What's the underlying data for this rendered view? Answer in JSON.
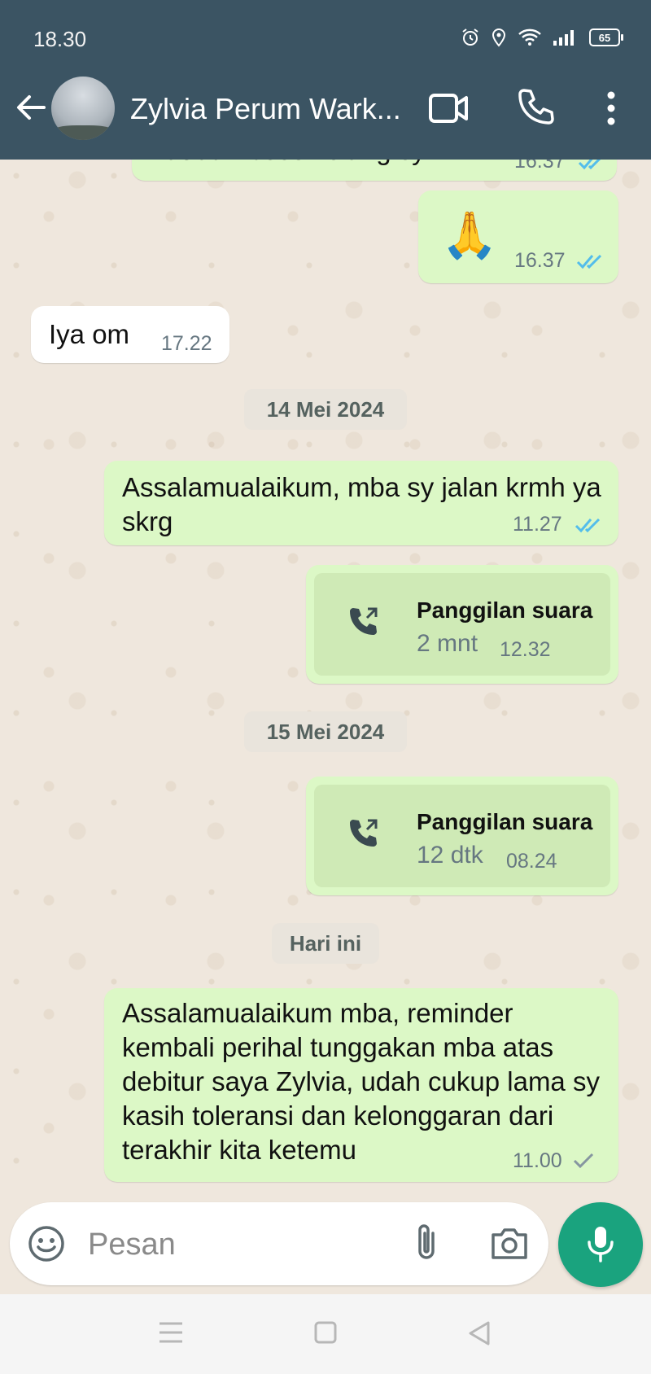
{
  "status_bar": {
    "time": "18.30",
    "battery": "65"
  },
  "header": {
    "contact_name": "Zylvia Perum Wark..."
  },
  "messages": {
    "m0": {
      "text": "Yaudah besok siang sy krmh",
      "time": "16.37"
    },
    "m1": {
      "emoji": "🙏",
      "time": "16.37"
    },
    "m2": {
      "text": "Iya om",
      "time": "17.22"
    },
    "d1": "14 Mei 2024",
    "m3": {
      "text": "Assalamualaikum, mba sy jalan krmh ya skrg",
      "time": "11.27"
    },
    "m4": {
      "title": "Panggilan suara",
      "duration": "2 mnt",
      "time": "12.32"
    },
    "d2": "15 Mei 2024",
    "m5": {
      "title": "Panggilan suara",
      "duration": "12 dtk",
      "time": "08.24"
    },
    "d3": "Hari ini",
    "m6": {
      "text": "Assalamualaikum mba, reminder kembali perihal tunggakan mba atas debitur saya Zylvia, udah cukup lama sy kasih toleransi dan kelonggaran dari terakhir kita ketemu",
      "time": "11.00"
    }
  },
  "composer": {
    "placeholder": "Pesan"
  },
  "icons": {
    "back": "arrow-left-icon",
    "video": "video-call-icon",
    "call": "phone-icon",
    "more": "more-vertical-icon",
    "emoji": "emoji-icon",
    "attach": "paperclip-icon",
    "camera": "camera-icon",
    "mic": "microphone-icon"
  },
  "colors": {
    "header": "#3b5463",
    "outgoing_bubble": "#dcf8c6",
    "incoming_bubble": "#ffffff",
    "read_tick": "#53bdeb",
    "mic_button": "#1aa37e"
  }
}
